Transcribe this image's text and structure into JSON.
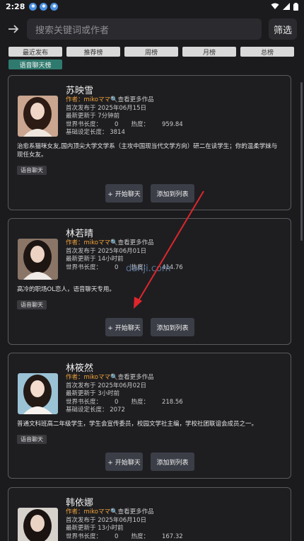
{
  "status": {
    "time": "2:28"
  },
  "search": {
    "placeholder": "搜索关键词或作者",
    "filter_label": "筛选"
  },
  "tabs": [
    "最近发布",
    "推荐榜",
    "周榜",
    "月榜",
    "总榜",
    "语音聊天榜"
  ],
  "labels": {
    "author_prefix": "作者：",
    "more_works": "🔍查看更多作品",
    "first_pub": "首次发布于",
    "last_update": "最新更新于",
    "world_len": "世界书长度：",
    "heat": "热度：",
    "base_len": "基础设定长度：",
    "start_chat": "+ 开始聊天",
    "add_list": "添加到列表"
  },
  "cards": [
    {
      "name": "苏映雪",
      "author": "mikoママ",
      "first_pub": "2025年06月15日",
      "last_update": "7分钟前",
      "world_len": "0",
      "heat": "959.84",
      "base_len": "3814",
      "desc": "治愈系猫咪女友,国内顶尖大学文学系（主攻中国现当代文学方向）研二在读学生；你的温柔学妹与现任女友。",
      "tag": "语音聊天",
      "colors": {
        "hair": "#2b1b14",
        "bg": "#caa58f",
        "skin": "#f0d6c6",
        "cloth": "#efe6e0"
      }
    },
    {
      "name": "林若晴",
      "author": "mikoママ",
      "first_pub": "2025年06月01日",
      "last_update": "14小时前",
      "world_len": "0",
      "heat": "414.76",
      "desc": "高冷的职场OL恋人，语音聊天专用。",
      "tag": "语音聊天",
      "colors": {
        "hair": "#1d1512",
        "bg": "#8a7566",
        "skin": "#ecd3c3",
        "cloth": "#efeae6"
      }
    },
    {
      "name": "林筱然",
      "author": "mikoママ",
      "first_pub": "2025年06月02日",
      "last_update": "3小时前",
      "world_len": "0",
      "heat": "218.56",
      "base_len": "2072",
      "desc": "普通文科班高二年级学生，学生会宣传委员，校园文学社主编，学校社团联谊会成员之一。",
      "tag": "语音聊天",
      "colors": {
        "hair": "#231a16",
        "bg": "#9bc3d6",
        "skin": "#f3dccd",
        "cloth": "#f6f2ee"
      }
    },
    {
      "name": "韩依娜",
      "author": "mikoママ",
      "first_pub": "2025年06月10日",
      "last_update": "13小时前",
      "world_len": "0",
      "heat": "167.32",
      "colors": {
        "hair": "#1a1311",
        "bg": "#d7d1cc",
        "skin": "#ead2c4",
        "cloth": "#222"
      }
    }
  ],
  "watermark": "danji.com"
}
